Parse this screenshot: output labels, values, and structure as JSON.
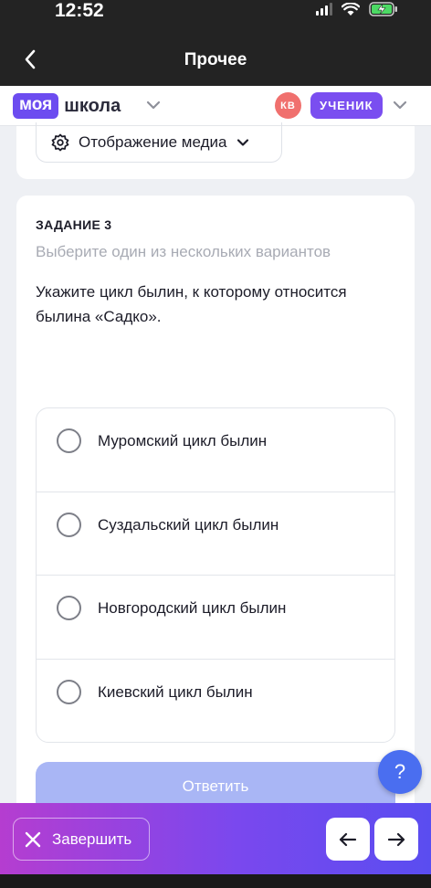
{
  "status": {
    "time": "12:52"
  },
  "nav": {
    "title": "Прочее"
  },
  "header": {
    "logo_part1": "моя",
    "logo_part2": "школа",
    "avatar_initials": "КВ",
    "role": "УЧЕНИК"
  },
  "media": {
    "label": "Отображение медиа"
  },
  "task": {
    "number": "ЗАДАНИЕ 3",
    "hint": "Выберите один из нескольких вариантов",
    "question": "Укажите цикл былин, к которому относится былина «Садко».",
    "options": [
      "Муромский цикл былин",
      "Суздальский цикл былин",
      "Новгородский цикл былин",
      "Киевский цикл былин"
    ],
    "answer_label": "Ответить"
  },
  "help": {
    "label": "?"
  },
  "footer": {
    "finish_label": "Завершить"
  },
  "colors": {
    "brand": "#6c4cf0",
    "answer_disabled": "#a9b6f5",
    "help": "#4a6ef0",
    "avatar": "#f0706e"
  },
  "icons": {
    "back": "chevron-left-icon",
    "media": "gear-icon",
    "finish": "close-icon",
    "prev": "arrow-left-icon",
    "next": "arrow-right-icon"
  }
}
